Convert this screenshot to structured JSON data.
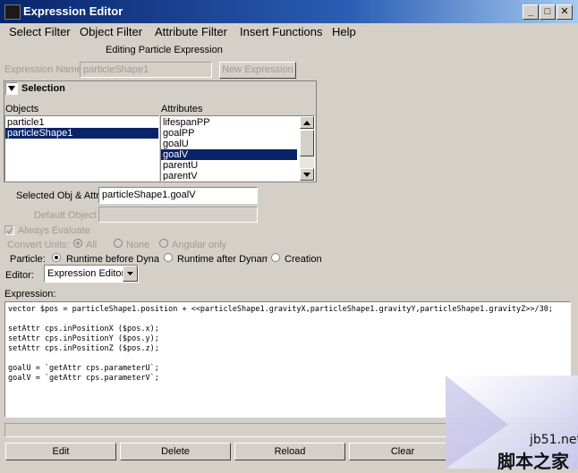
{
  "window": {
    "title": "Expression Editor",
    "controls": {
      "minimize": "_",
      "maximize": "□",
      "close": "✕"
    }
  },
  "menu": [
    "Select Filter",
    "Object Filter",
    "Attribute Filter",
    "Insert Functions",
    "Help"
  ],
  "header": "Editing Particle Expression",
  "expression_name": {
    "label": "Expression Name",
    "value": "particleShape1",
    "new_button": "New Expression"
  },
  "selection": {
    "title": "Selection",
    "objects_label": "Objects",
    "attributes_label": "Attributes",
    "objects": [
      "particle1",
      "particleShape1"
    ],
    "objects_selected": 1,
    "attributes": [
      "lifespanPP",
      "goalPP",
      "goalU",
      "goalV",
      "parentU",
      "parentV"
    ],
    "attributes_selected": 3
  },
  "selected_obj_attr": {
    "label": "Selected Obj & Attr",
    "value": "particleShape1.goalV"
  },
  "default_object": {
    "label": "Default Object",
    "value": ""
  },
  "always_evaluate": "Always Evaluate",
  "convert_units": {
    "label": "Convert Units:",
    "options": [
      "All",
      "None",
      "Angular only"
    ],
    "selected": 0
  },
  "particle": {
    "label": "Particle:",
    "options": [
      "Runtime before Dynami",
      "Runtime after Dynamic",
      "Creation"
    ],
    "selected": 0
  },
  "editor": {
    "label": "Editor:",
    "value": "Expression Editor"
  },
  "expression": {
    "label": "Expression:",
    "lines": [
      "vector $pos = particleShape1.position + <<particleShape1.gravityX,particleShape1.gravityY,particleShape1.gravityZ>>/30;",
      "",
      "setAttr cps.inPositionX ($pos.x);",
      "setAttr cps.inPositionY ($pos.y);",
      "setAttr cps.inPositionZ ($pos.z);",
      "",
      "goalU = `getAttr cps.parameterU`;",
      "goalV = `getAttr cps.parameterV`;"
    ]
  },
  "buttons": {
    "edit": "Edit",
    "delete": "Delete",
    "reload": "Reload",
    "clear": "Clear"
  },
  "watermark": {
    "line1": "jb51.net",
    "line2": "脚本之家"
  }
}
